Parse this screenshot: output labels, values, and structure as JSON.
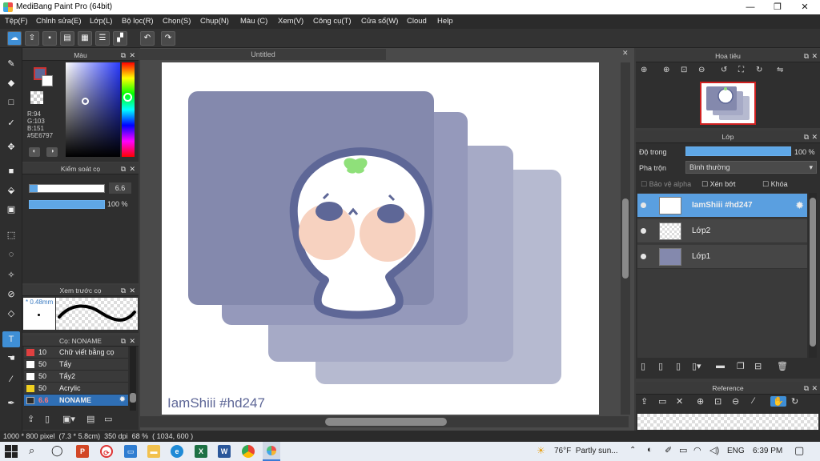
{
  "window": {
    "title": "MediBang Paint Pro (64bit)"
  },
  "menu": [
    "Tệp(F)",
    "Chỉnh sửa(E)",
    "Lớp(L)",
    "Bộ lọc(R)",
    "Chọn(S)",
    "Chụp(N)",
    "Màu (C)",
    "Xem(V)",
    "Công cụ(T)",
    "Cửa sổ(W)",
    "Cloud",
    "Help"
  ],
  "color_panel": {
    "title": "Màu",
    "r": "R:94",
    "g": "G:103",
    "b": "B:151",
    "hex": "#5E6797",
    "primary_color": "#5e6797"
  },
  "brush_control": {
    "title": "Kiểm soát cọ",
    "size_value": "6.6",
    "opacity_value": "100 %",
    "opacity_fraction": 1.0
  },
  "brush_preview": {
    "title": "Xem trước cọ",
    "size_label": "* 0.48mm"
  },
  "brush_list": {
    "title": "Cọ: NONAME",
    "items": [
      {
        "size": "10",
        "name": "Chữ viết bằng cọ",
        "color": "#e04040"
      },
      {
        "size": "50",
        "name": "Tẩy",
        "color": "#ffffff"
      },
      {
        "size": "50",
        "name": "Tẩy2",
        "color": "#ffffff"
      },
      {
        "size": "50",
        "name": "Acrylic",
        "color": "#f0d020"
      },
      {
        "size": "6.6",
        "name": "NONAME",
        "color": "#2b2b2b",
        "selected": true
      }
    ]
  },
  "document": {
    "tab_title": "Untitled",
    "watermark_text": "IamShiii #hd247"
  },
  "navigator": {
    "title": "Hoa tiêu"
  },
  "layers": {
    "title": "Lớp",
    "opacity_label": "Độ trong",
    "opacity_value": "100 %",
    "blend_label": "Pha trộn",
    "blend_value": "Bình thường",
    "protect_alpha": "Bảo vệ alpha",
    "clipping": "Xén bớt",
    "lock": "Khóa",
    "items": [
      {
        "name": "IamShiii #hd247",
        "selected": true
      },
      {
        "name": "Lớp2",
        "selected": false
      },
      {
        "name": "Lớp1",
        "selected": false
      }
    ]
  },
  "reference": {
    "title": "Reference"
  },
  "status": {
    "text": "1000 * 800 pixel  (7.3 * 5.8cm)  350 dpi  68 %  ( 1034, 600 )"
  },
  "taskbar": {
    "weather": "76°F  Partly sun...",
    "lang": "ENG",
    "time": "6:39 PM"
  }
}
